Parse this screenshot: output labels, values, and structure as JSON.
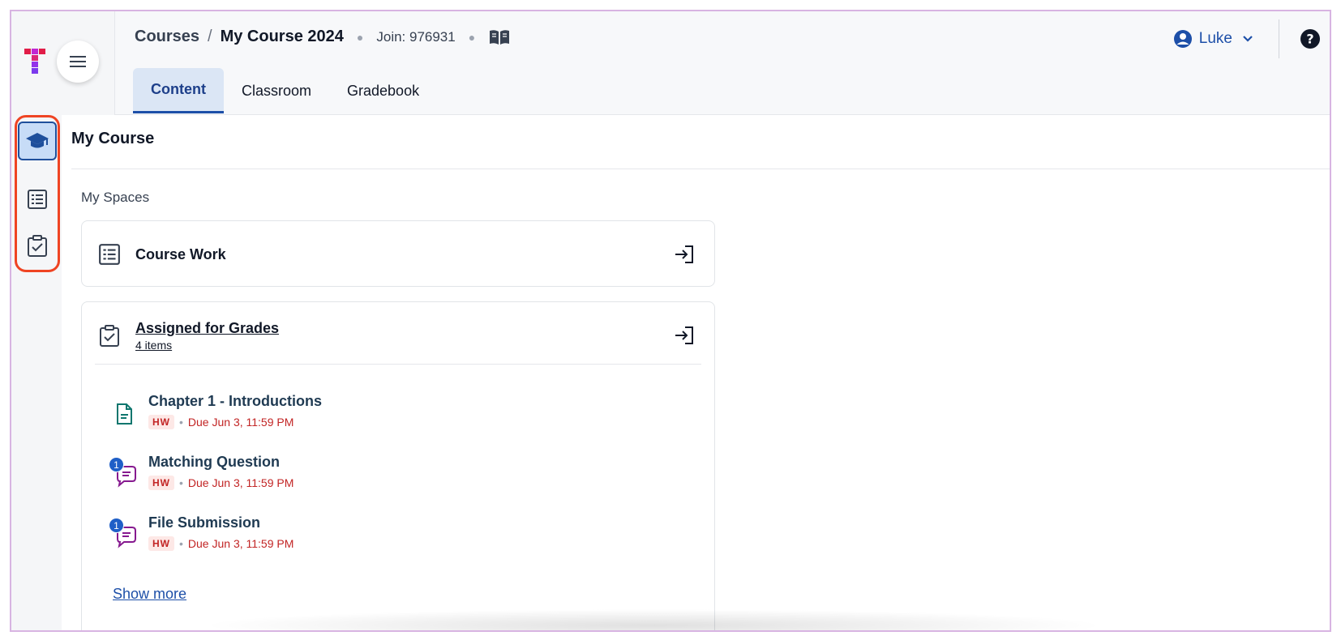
{
  "header": {
    "breadcrumb_root": "Courses",
    "breadcrumb_sep": "/",
    "course_name": "My Course 2024",
    "join_code": "Join: 976931",
    "user_name": "Luke"
  },
  "tabs": [
    {
      "label": "Content",
      "active": true
    },
    {
      "label": "Classroom",
      "active": false
    },
    {
      "label": "Gradebook",
      "active": false
    }
  ],
  "rail": {
    "items": [
      {
        "icon": "graduation-cap-icon",
        "active": true
      },
      {
        "icon": "list-icon",
        "active": false
      },
      {
        "icon": "clipboard-check-icon",
        "active": false
      }
    ]
  },
  "main": {
    "title": "My Course",
    "section_label": "My Spaces",
    "course_work": {
      "title": "Course Work"
    },
    "assigned": {
      "title": "Assigned for Grades",
      "count": "4 items",
      "items": [
        {
          "title": "Chapter 1 - Introductions",
          "tag": "HW",
          "due": "Due Jun 3, 11:59 PM",
          "icon": "document-icon",
          "badge": ""
        },
        {
          "title": "Matching Question",
          "tag": "HW",
          "due": "Due Jun 3, 11:59 PM",
          "icon": "discussion-icon",
          "badge": "1"
        },
        {
          "title": "File Submission",
          "tag": "HW",
          "due": "Due Jun 3, 11:59 PM",
          "icon": "discussion-icon",
          "badge": "1"
        }
      ],
      "show_more": "Show more"
    }
  },
  "colors": {
    "accent": "#1d4fa8",
    "due_red": "#c22424",
    "highlight": "#ef4423"
  }
}
